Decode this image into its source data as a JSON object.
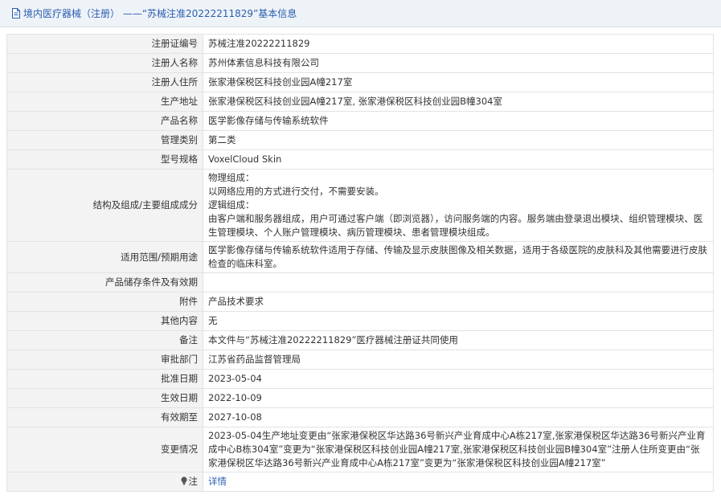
{
  "header": {
    "title": "境内医疗器械（注册） ——“苏械注准20222211829”基本信息"
  },
  "rows": [
    {
      "label": "注册证编号",
      "value": "苏械注准20222211829"
    },
    {
      "label": "注册人名称",
      "value": "苏州体素信息科技有限公司"
    },
    {
      "label": "注册人住所",
      "value": "张家港保税区科技创业园A幢217室"
    },
    {
      "label": "生产地址",
      "value": "张家港保税区科技创业园A幢217室, 张家港保税区科技创业园B幢304室"
    },
    {
      "label": "产品名称",
      "value": "医学影像存储与传输系统软件"
    },
    {
      "label": "管理类别",
      "value": "第二类"
    },
    {
      "label": "型号规格",
      "value": "VoxelCloud Skin"
    },
    {
      "label": "结构及组成/主要组成成分",
      "lines": [
        "物理组成：",
        "以网络应用的方式进行交付，不需要安装。",
        "逻辑组成：",
        "由客户端和服务器组成，用户可通过客户端（即浏览器），访问服务端的内容。服务端由登录退出模块、组织管理模块、医生管理模块、个人账户管理模块、病历管理模块、患者管理模块组成。"
      ]
    },
    {
      "label": "适用范围/预期用途",
      "value": "医学影像存储与传输系统软件适用于存储、传输及显示皮肤图像及相关数据，适用于各级医院的皮肤科及其他需要进行皮肤检查的临床科室。"
    },
    {
      "label": "产品储存条件及有效期",
      "value": ""
    },
    {
      "label": "附件",
      "value": "产品技术要求"
    },
    {
      "label": "其他内容",
      "value": "无"
    },
    {
      "label": "备注",
      "value": "本文件与“苏械注准20222211829”医疗器械注册证共同使用"
    },
    {
      "label": "审批部门",
      "value": "江苏省药品监督管理局"
    },
    {
      "label": "批准日期",
      "value": "2023-05-04"
    },
    {
      "label": "生效日期",
      "value": "2022-10-09"
    },
    {
      "label": "有效期至",
      "value": "2027-10-08"
    },
    {
      "label": "变更情况",
      "value": "2023-05-04生产地址变更由“张家港保税区华达路36号新兴产业育成中心A栋217室,张家港保税区华达路36号新兴产业育成中心B栋304室”变更为“张家港保税区科技创业园A幢217室,张家港保税区科技创业园B幢304室”注册人住所变更由“张家港保税区华达路36号新兴产业育成中心A栋217室”变更为“张家港保税区科技创业园A幢217室”"
    }
  ],
  "note": {
    "label": "注",
    "icon": "lightbulb-icon",
    "link_text": "详情"
  }
}
